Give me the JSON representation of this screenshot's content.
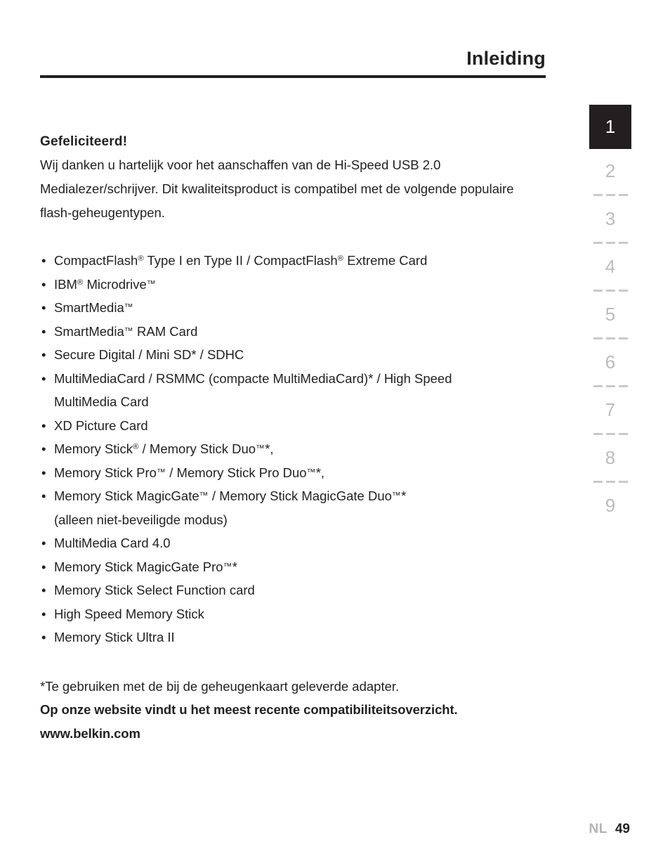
{
  "header": {
    "title": "Inleiding"
  },
  "body": {
    "heading": "Gefeliciteerd!",
    "intro": "Wij danken u hartelijk voor het aanschaffen van de Hi-Speed USB 2.0 Medialezer/schrijver. Dit kwaliteitsproduct is compatibel met de volgende populaire flash-geheugentypen."
  },
  "cards": [
    {
      "text": "CompactFlash® Type I en Type II / CompactFlash® Extreme Card",
      "parts": [
        {
          "t": "CompactFlash"
        },
        {
          "t": "®",
          "s": "reg"
        },
        {
          "t": " Type I en Type II / CompactFlash"
        },
        {
          "t": "®",
          "s": "reg"
        },
        {
          "t": " Extreme Card"
        }
      ]
    },
    {
      "text": "IBM® Microdrive™",
      "parts": [
        {
          "t": "IBM"
        },
        {
          "t": "®",
          "s": "reg"
        },
        {
          "t": " Microdrive"
        },
        {
          "t": "™",
          "s": "tm"
        }
      ]
    },
    {
      "text": "SmartMedia™",
      "parts": [
        {
          "t": "SmartMedia"
        },
        {
          "t": "™",
          "s": "tm"
        }
      ]
    },
    {
      "text": "SmartMedia™ RAM Card",
      "parts": [
        {
          "t": "SmartMedia"
        },
        {
          "t": "™",
          "s": "tm"
        },
        {
          "t": " RAM Card"
        }
      ]
    },
    {
      "text": "Secure Digital / Mini SD* / SDHC",
      "parts": [
        {
          "t": "Secure Digital / Mini SD* / SDHC"
        }
      ]
    },
    {
      "text": "MultiMediaCard / RSMMC (compacte MultiMediaCard)* / High Speed MultiMedia Card",
      "parts": [
        {
          "t": "MultiMediaCard / RSMMC (compacte MultiMediaCard)* / High Speed"
        }
      ],
      "wrap": "MultiMedia Card"
    },
    {
      "text": "XD Picture Card",
      "parts": [
        {
          "t": "XD Picture Card"
        }
      ]
    },
    {
      "text": "Memory Stick® / Memory Stick Duo™*,",
      "parts": [
        {
          "t": "Memory Stick"
        },
        {
          "t": "®",
          "s": "reg"
        },
        {
          "t": " / Memory Stick Duo"
        },
        {
          "t": "™",
          "s": "tm"
        },
        {
          "t": "*,"
        }
      ]
    },
    {
      "text": "Memory Stick Pro™ / Memory Stick Pro Duo™*,",
      "parts": [
        {
          "t": "Memory Stick Pro"
        },
        {
          "t": "™",
          "s": "tm"
        },
        {
          "t": " / Memory Stick Pro Duo"
        },
        {
          "t": "™",
          "s": "tm"
        },
        {
          "t": "*,"
        }
      ]
    },
    {
      "text": "Memory Stick MagicGate™ / Memory Stick MagicGate Duo™* (alleen niet-beveiligde modus)",
      "parts": [
        {
          "t": "Memory Stick MagicGate"
        },
        {
          "t": "™",
          "s": "tm"
        },
        {
          "t": " / Memory Stick MagicGate Duo"
        },
        {
          "t": "™",
          "s": "tm"
        },
        {
          "t": "*"
        }
      ],
      "wrap": "(alleen niet-beveiligde modus)"
    },
    {
      "text": "MultiMedia Card 4.0",
      "parts": [
        {
          "t": "MultiMedia Card 4.0"
        }
      ]
    },
    {
      "text": "Memory Stick MagicGate Pro™*",
      "parts": [
        {
          "t": "Memory Stick MagicGate Pro"
        },
        {
          "t": "™",
          "s": "tm"
        },
        {
          "t": "*"
        }
      ]
    },
    {
      "text": "Memory Stick Select Function card",
      "parts": [
        {
          "t": "Memory Stick Select Function card"
        }
      ]
    },
    {
      "text": "High Speed Memory Stick",
      "parts": [
        {
          "t": "High Speed Memory Stick"
        }
      ]
    },
    {
      "text": "Memory Stick Ultra II",
      "parts": [
        {
          "t": "Memory Stick Ultra II"
        }
      ]
    }
  ],
  "bullet_glyph": "•",
  "notes": [
    {
      "text": "*Te gebruiken met de bij de geheugenkaart geleverde adapter.",
      "bold": false
    },
    {
      "text": "Op onze website vindt u het meest recente compatibiliteitsoverzicht.",
      "bold": true
    },
    {
      "text": "www.belkin.com",
      "bold": true
    }
  ],
  "section_rail": {
    "items": [
      {
        "label": "1",
        "active": true
      },
      {
        "label": "2",
        "active": false
      },
      {
        "label": "3",
        "active": false
      },
      {
        "label": "4",
        "active": false
      },
      {
        "label": "5",
        "active": false
      },
      {
        "label": "6",
        "active": false
      },
      {
        "label": "7",
        "active": false
      },
      {
        "label": "8",
        "active": false
      },
      {
        "label": "9",
        "active": false
      }
    ],
    "active_color": "#231f20",
    "inactive_color": "#bcbcbc"
  },
  "footer": {
    "language": "NL",
    "page_number": "49"
  }
}
